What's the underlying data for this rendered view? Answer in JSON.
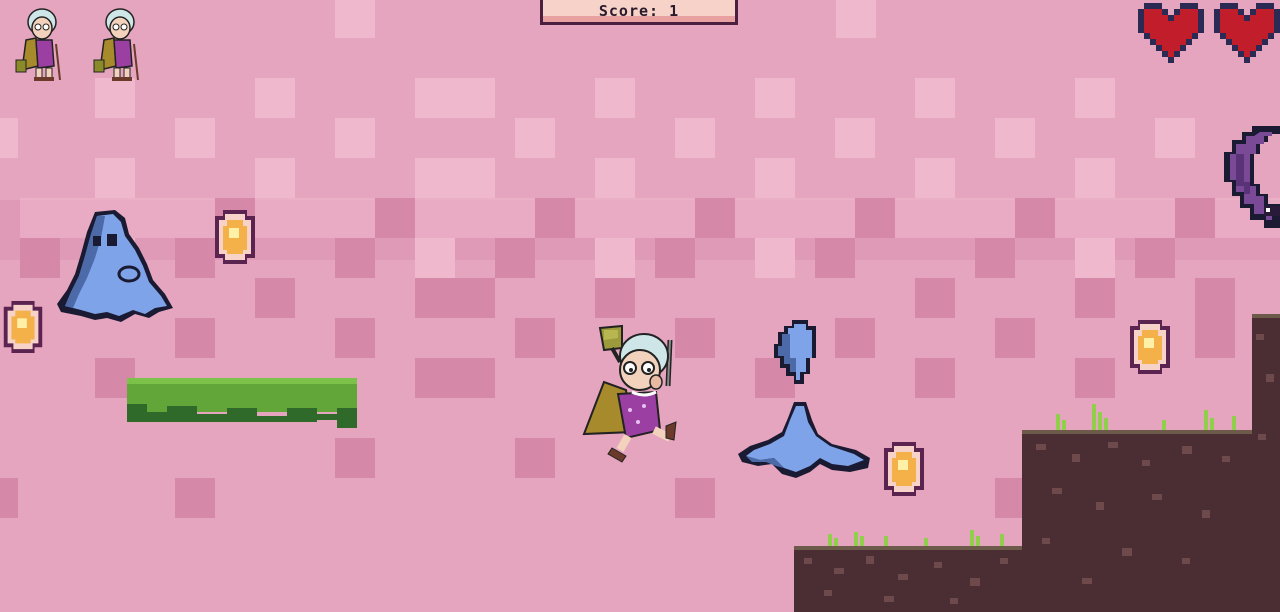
{
  "hud": {
    "score_text": "Score: 1",
    "lives": {
      "count": 2,
      "icon": "grandma-life-icon"
    },
    "health": {
      "hearts": 2,
      "icon": "heart-icon",
      "color": "#c21d2a"
    }
  },
  "scene": {
    "background_light": "#e5a5be",
    "background_dark": "#d992af",
    "player": "grandma-player",
    "enemies": [
      "blue-blob-ghost",
      "blue-splash-creature",
      "purple-crescent-enemy"
    ],
    "coins": 4,
    "platforms": [
      "grass-floating-platform",
      "dirt-ground-low",
      "dirt-ground-mid",
      "dirt-pillar-right"
    ]
  }
}
